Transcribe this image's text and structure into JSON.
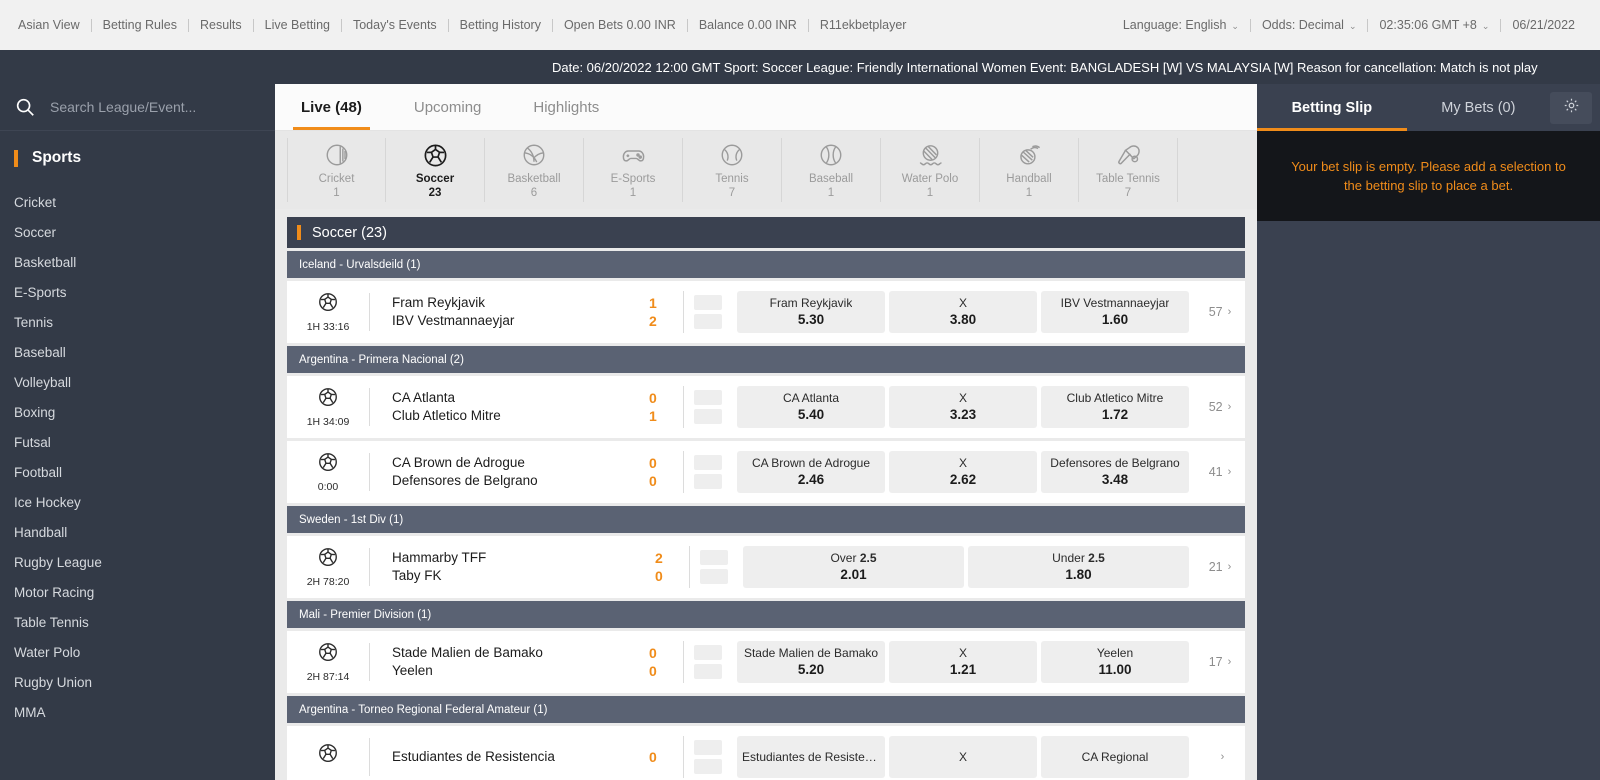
{
  "topbar": {
    "nav": [
      "Asian View",
      "Betting Rules",
      "Results",
      "Live Betting",
      "Today's Events",
      "Betting History",
      "Open Bets 0.00 INR",
      "Balance 0.00 INR",
      "R11ekbetplayer"
    ],
    "language": "Language: English",
    "odds": "Odds: Decimal",
    "clock": "02:35:06 GMT +8",
    "date": "06/21/2022"
  },
  "announcement": {
    "text": "Date: 06/20/2022 12:00 GMT Sport: Soccer League: Friendly International Women Event: BANGLADESH [W] VS MALAYSIA [W] Reason for cancellation: Match is not play"
  },
  "sidebar": {
    "search_placeholder": "Search League/Event...",
    "header": "Sports",
    "items": [
      {
        "label": "Cricket"
      },
      {
        "label": "Soccer"
      },
      {
        "label": "Basketball"
      },
      {
        "label": "E-Sports"
      },
      {
        "label": "Tennis"
      },
      {
        "label": "Baseball"
      },
      {
        "label": "Volleyball"
      },
      {
        "label": "Boxing"
      },
      {
        "label": "Futsal"
      },
      {
        "label": "Football"
      },
      {
        "label": "Ice Hockey"
      },
      {
        "label": "Handball"
      },
      {
        "label": "Rugby League"
      },
      {
        "label": "Motor Racing"
      },
      {
        "label": "Table Tennis"
      },
      {
        "label": "Water Polo"
      },
      {
        "label": "Rugby Union"
      },
      {
        "label": "MMA"
      }
    ]
  },
  "tabs": [
    {
      "label": "Live (48)",
      "active": true
    },
    {
      "label": "Upcoming",
      "active": false
    },
    {
      "label": "Highlights",
      "active": false
    }
  ],
  "sportbar": [
    {
      "name": "Cricket",
      "count": "1",
      "icon": "cricket-ball-icon",
      "active": false
    },
    {
      "name": "Soccer",
      "count": "23",
      "icon": "soccer-ball-icon",
      "active": true
    },
    {
      "name": "Basketball",
      "count": "6",
      "icon": "basketball-icon",
      "active": false
    },
    {
      "name": "E-Sports",
      "count": "1",
      "icon": "gamepad-icon",
      "active": false
    },
    {
      "name": "Tennis",
      "count": "7",
      "icon": "tennis-ball-icon",
      "active": false
    },
    {
      "name": "Baseball",
      "count": "1",
      "icon": "baseball-icon",
      "active": false
    },
    {
      "name": "Water Polo",
      "count": "1",
      "icon": "water-polo-icon",
      "active": false
    },
    {
      "name": "Handball",
      "count": "1",
      "icon": "handball-icon",
      "active": false
    },
    {
      "name": "Table Tennis",
      "count": "7",
      "icon": "table-tennis-icon",
      "active": false
    }
  ],
  "category_header": "Soccer (23)",
  "groups": [
    {
      "league": "Iceland - Urvalsdeild (1)",
      "matches": [
        {
          "clock": "1H 33:16",
          "home": "Fram Reykjavik",
          "away": "IBV Vestmannaeyjar",
          "home_score": "1",
          "away_score": "2",
          "market": "1x2",
          "odds": [
            {
              "label": "Fram Reykjavik",
              "value": "5.30"
            },
            {
              "label": "X",
              "value": "3.80"
            },
            {
              "label": "IBV Vestmannaeyjar",
              "value": "1.60"
            }
          ],
          "more": "57"
        }
      ]
    },
    {
      "league": "Argentina - Primera Nacional (2)",
      "matches": [
        {
          "clock": "1H 34:09",
          "home": "CA Atlanta",
          "away": "Club Atletico Mitre",
          "home_score": "0",
          "away_score": "1",
          "market": "1x2",
          "odds": [
            {
              "label": "CA Atlanta",
              "value": "5.40"
            },
            {
              "label": "X",
              "value": "3.23"
            },
            {
              "label": "Club Atletico Mitre",
              "value": "1.72"
            }
          ],
          "more": "52"
        },
        {
          "clock": "0:00",
          "home": "CA Brown de Adrogue",
          "away": "Defensores de Belgrano",
          "home_score": "0",
          "away_score": "0",
          "market": "1x2",
          "odds": [
            {
              "label": "CA Brown de Adrogue",
              "value": "2.46"
            },
            {
              "label": "X",
              "value": "2.62"
            },
            {
              "label": "Defensores de Belgrano",
              "value": "3.48"
            }
          ],
          "more": "41"
        }
      ]
    },
    {
      "league": "Sweden - 1st Div (1)",
      "matches": [
        {
          "clock": "2H 78:20",
          "home": "Hammarby TFF",
          "away": "Taby FK",
          "home_score": "2",
          "away_score": "0",
          "market": "overunder",
          "odds": [
            {
              "label": "Over",
              "line": "2.5",
              "value": "2.01"
            },
            {
              "label": "Under",
              "line": "2.5",
              "value": "1.80"
            }
          ],
          "more": "21"
        }
      ]
    },
    {
      "league": "Mali - Premier Division (1)",
      "matches": [
        {
          "clock": "2H 87:14",
          "home": "Stade Malien de Bamako",
          "away": "Yeelen",
          "home_score": "0",
          "away_score": "0",
          "market": "1x2",
          "odds": [
            {
              "label": "Stade Malien de Bamako",
              "value": "5.20"
            },
            {
              "label": "X",
              "value": "1.21"
            },
            {
              "label": "Yeelen",
              "value": "11.00"
            }
          ],
          "more": "17"
        }
      ]
    },
    {
      "league": "Argentina - Torneo Regional Federal Amateur (1)",
      "matches": [
        {
          "clock": "",
          "home": "Estudiantes de Resistencia",
          "away": "",
          "home_score": "0",
          "away_score": "",
          "market": "1x2",
          "odds": [
            {
              "label": "Estudiantes de Resisten...",
              "value": ""
            },
            {
              "label": "X",
              "value": ""
            },
            {
              "label": "CA Regional",
              "value": ""
            }
          ],
          "more": ""
        }
      ]
    }
  ],
  "betslip": {
    "tab_slip": "Betting Slip",
    "tab_mybets": "My Bets (0)",
    "empty_message": "Your bet slip is empty. Please add a selection to the betting slip to place a bet."
  },
  "colors": {
    "accent": "#f08c1a",
    "dark": "#333a47",
    "slate": "#5a6273",
    "panel": "#3a4150"
  }
}
